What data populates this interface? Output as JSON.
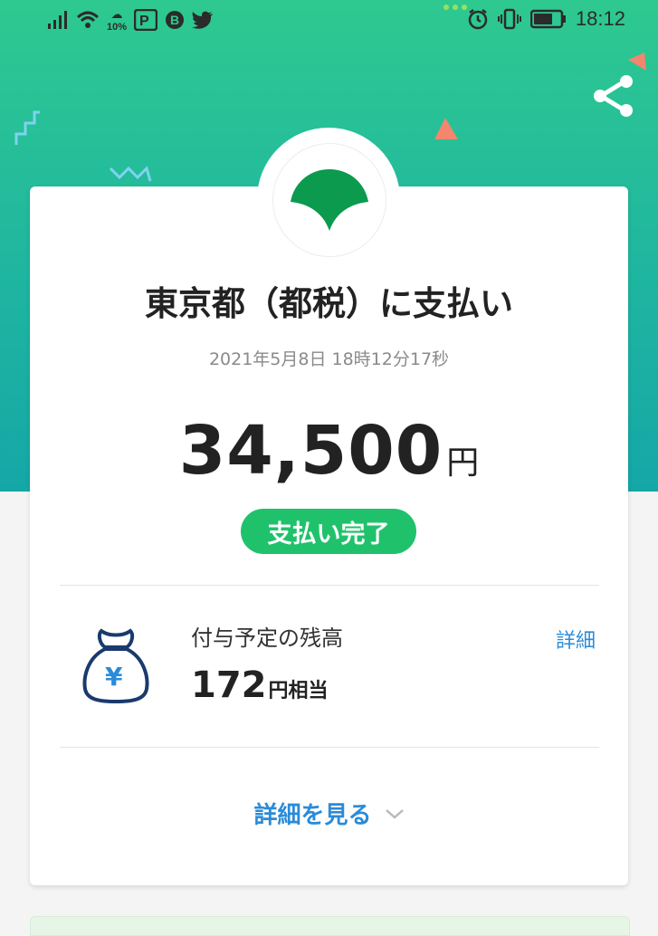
{
  "status_bar": {
    "battery_level": "10%",
    "time": "18:12",
    "icons": [
      "signal-icon",
      "wifi-icon",
      "weather-icon",
      "paypay-icon",
      "bitcoin-icon",
      "twitter-icon",
      "alarm-icon",
      "vibrate-icon",
      "battery-icon"
    ]
  },
  "payment": {
    "title": "東京都（都税）に支払い",
    "datetime": "2021年5月8日 18時12分17秒",
    "amount": "34,500",
    "amount_unit": "円",
    "status": "支払い完了"
  },
  "balance": {
    "label": "付与予定の残高",
    "value": "172",
    "value_unit": "円相当",
    "detail_link": "詳細"
  },
  "see_more": {
    "label": "詳細を見る"
  },
  "colors": {
    "hero_top": "#2ec990",
    "hero_bottom": "#15a7a7",
    "status_green": "#1fc26b",
    "link_blue": "#2b8bd8",
    "logo_green": "#0b9a4e"
  }
}
